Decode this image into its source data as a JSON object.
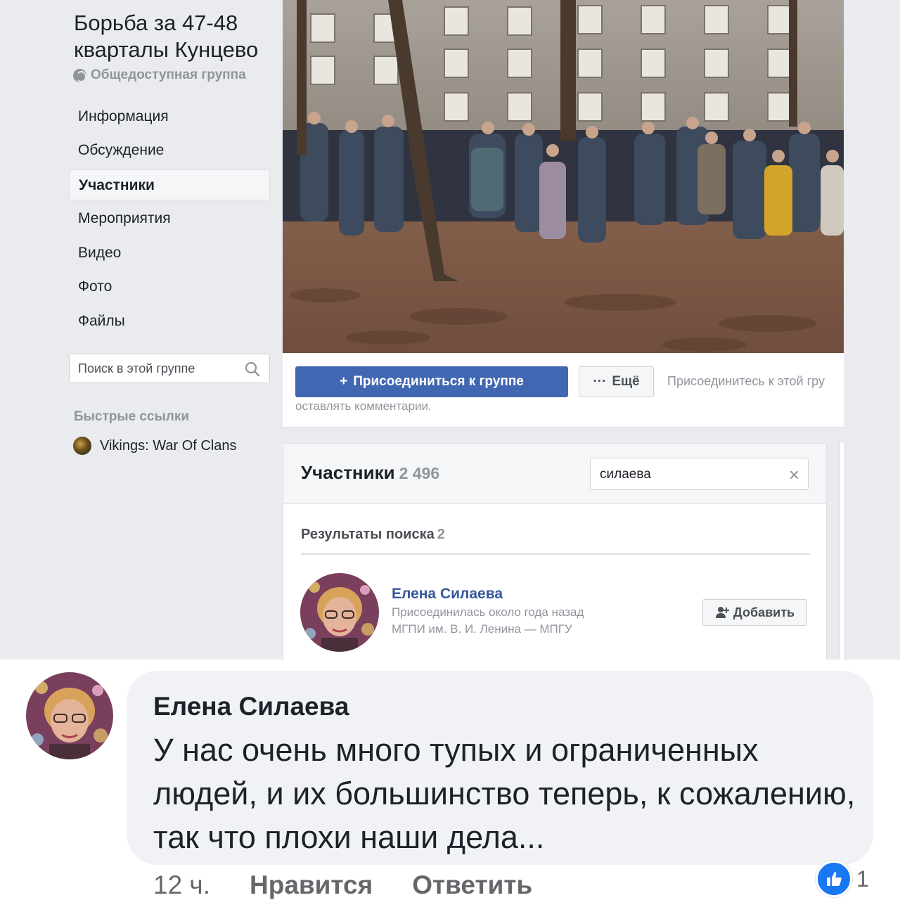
{
  "group": {
    "title": "Борьба за 47-48 кварталы Кунцево",
    "privacy": "Общедоступная группа"
  },
  "sidebar": {
    "items": [
      {
        "label": "Информация"
      },
      {
        "label": "Обсуждение"
      },
      {
        "label": "Участники"
      },
      {
        "label": "Мероприятия"
      },
      {
        "label": "Видео"
      },
      {
        "label": "Фото"
      },
      {
        "label": "Файлы"
      }
    ],
    "search_placeholder": "Поиск в этой группе",
    "quick_links_title": "Быстрые ссылки",
    "quick_link": "Vikings: War Of Clans"
  },
  "actions": {
    "join_label": "Присоединиться к группе",
    "join_plus": "+",
    "more_dots": "···",
    "more_label": "Ещё",
    "hint_line1": "Присоединитесь к этой гру",
    "hint_line2": "оставлять комментарии."
  },
  "members": {
    "title": "Участники",
    "count": "2 496",
    "search_value": "силаева",
    "clear_symbol": "×",
    "results_title": "Результаты поиска",
    "results_count": "2",
    "result": {
      "name": "Елена Силаева",
      "joined": "Присоединилась около года назад",
      "school": "МГПИ им. В. И. Ленина — МПГУ",
      "add_label": "Добавить"
    }
  },
  "comment": {
    "author": "Елена Силаева",
    "text": "У нас очень много  тупых и ограниченных людей, и их большинство теперь, к сожалению, так что плохи наши дела...",
    "time": "12 ч.",
    "like_action": "Нравится",
    "reply_action": "Ответить",
    "reaction_count": "1"
  },
  "colors": {
    "fb_blue": "#4267b2",
    "link_blue": "#365899",
    "like_blue": "#1877f2",
    "page_bg": "#e9ebee"
  }
}
